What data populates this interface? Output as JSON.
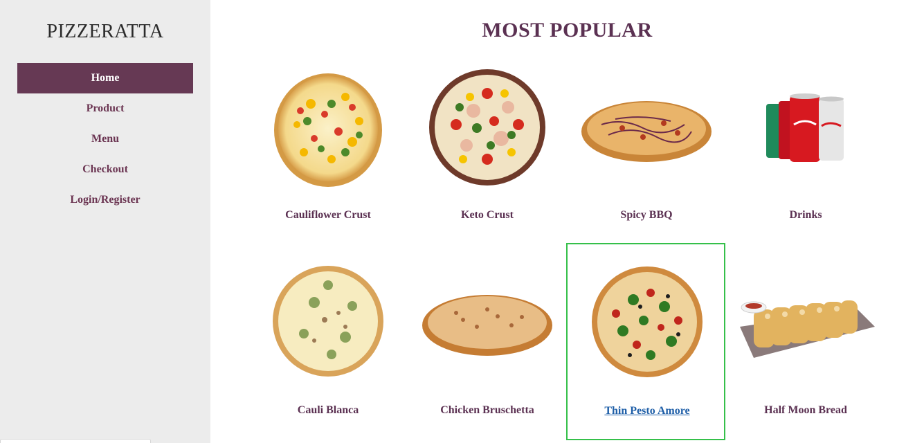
{
  "brand": "PIZZERATTA",
  "nav": {
    "items": [
      {
        "label": "Home",
        "active": true
      },
      {
        "label": "Product"
      },
      {
        "label": "Menu"
      },
      {
        "label": "Checkout"
      },
      {
        "label": "Login/Register"
      }
    ]
  },
  "main": {
    "title": "MOST POPULAR",
    "products": [
      {
        "name": "Cauliflower Crust",
        "icon": "cauliflower-crust-pizza"
      },
      {
        "name": "Keto Crust",
        "icon": "keto-crust-pizza"
      },
      {
        "name": "Spicy BBQ",
        "icon": "spicy-bbq-pizza"
      },
      {
        "name": "Drinks",
        "icon": "soda-cans"
      },
      {
        "name": "Cauli Blanca",
        "icon": "cauli-blanca-pizza"
      },
      {
        "name": "Chicken Bruschetta",
        "icon": "chicken-bruschetta-pizza"
      },
      {
        "name": "Thin Pesto Amore",
        "icon": "thin-pesto-amore-pizza",
        "selected": true
      },
      {
        "name": "Half Moon Bread",
        "icon": "half-moon-bread"
      }
    ]
  },
  "colors": {
    "accent": "#663954",
    "sidebar_bg": "#ececec",
    "selection_border": "#35c04a",
    "link": "#1f5fa8"
  }
}
